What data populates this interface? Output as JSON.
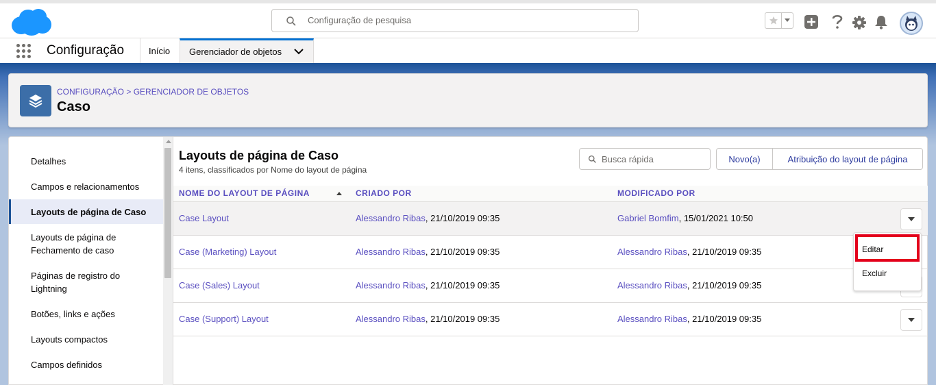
{
  "header": {
    "search_placeholder": "Configuração de pesquisa"
  },
  "context_bar": {
    "app_name": "Configuração",
    "tabs": [
      {
        "label": "Início"
      },
      {
        "label": "Gerenciador de objetos"
      }
    ]
  },
  "page_header": {
    "breadcrumb_1": "CONFIGURAÇÃO",
    "breadcrumb_sep": " > ",
    "breadcrumb_2": "GERENCIADOR DE OBJETOS",
    "title": "Caso"
  },
  "sidebar": {
    "items": [
      {
        "label": "Detalhes"
      },
      {
        "label": "Campos e relacionamentos"
      },
      {
        "label": "Layouts de página de Caso"
      },
      {
        "label": "Layouts de página de Fechamento de caso"
      },
      {
        "label": "Páginas de registro do Lightning"
      },
      {
        "label": "Botões, links e ações"
      },
      {
        "label": "Layouts compactos"
      },
      {
        "label": "Campos definidos"
      }
    ]
  },
  "list": {
    "title": "Layouts de página de Caso",
    "subtitle": "4 itens, classificados por Nome do layout de página",
    "quick_find_placeholder": "Busca rápida",
    "new_label": "Novo(a)",
    "assign_label": "Atribuição do layout de página",
    "columns": [
      "NOME DO LAYOUT DE PÁGINA",
      "CRIADO POR",
      "MODIFICADO POR"
    ],
    "rows": [
      {
        "name": "Case Layout",
        "created_by": "Alessandro Ribas",
        "created_at": ", 21/10/2019 09:35",
        "modified_by": "Gabriel Bomfim",
        "modified_at": ", 15/01/2021 10:50"
      },
      {
        "name": "Case (Marketing) Layout",
        "created_by": "Alessandro Ribas",
        "created_at": ", 21/10/2019 09:35",
        "modified_by": "Alessandro Ribas",
        "modified_at": ", 21/10/2019 09:35"
      },
      {
        "name": "Case (Sales) Layout",
        "created_by": "Alessandro Ribas",
        "created_at": ", 21/10/2019 09:35",
        "modified_by": "Alessandro Ribas",
        "modified_at": ", 21/10/2019 09:35"
      },
      {
        "name": "Case (Support) Layout",
        "created_by": "Alessandro Ribas",
        "created_at": ", 21/10/2019 09:35",
        "modified_by": "Alessandro Ribas",
        "modified_at": ", 21/10/2019 09:35"
      }
    ]
  },
  "row_menu": {
    "items": [
      {
        "label": "Editar"
      },
      {
        "label": "Excluir"
      }
    ]
  },
  "colors": {
    "brand": "#0070d2",
    "link": "#5a4fc0",
    "highlight": "#e3001b",
    "object_icon": "#3c6ea8"
  }
}
